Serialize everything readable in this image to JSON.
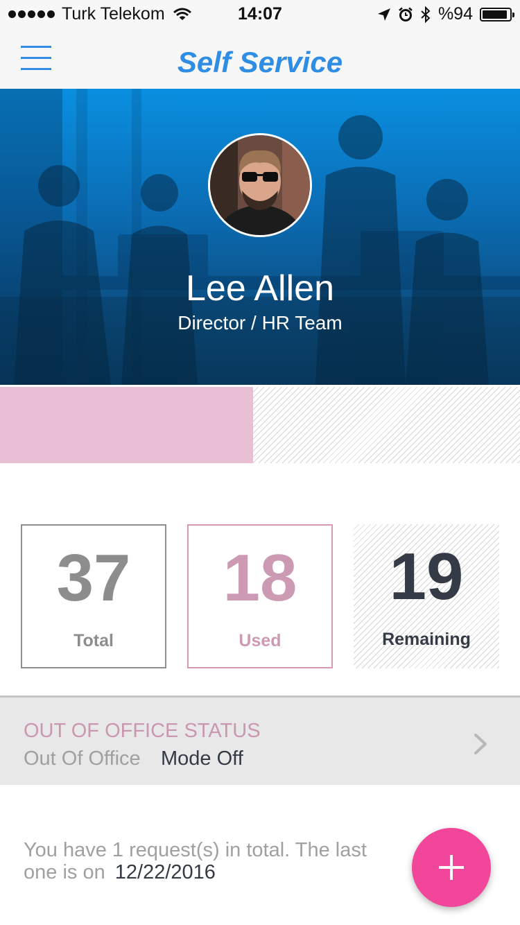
{
  "status_bar": {
    "carrier": "Turk Telekom",
    "time": "14:07",
    "battery_text": "%94",
    "battery_level": 0.94,
    "icons": [
      "signal-dots-icon",
      "wifi-icon",
      "location-arrow-icon",
      "alarm-icon",
      "bluetooth-icon",
      "battery-icon"
    ]
  },
  "nav": {
    "title": "Self Service",
    "menu_icon": "hamburger-menu-icon",
    "accent_color": "#2f8de4"
  },
  "profile": {
    "name": "Lee Allen",
    "role": "Director / HR Team",
    "avatar_icon": "user-avatar"
  },
  "leave": {
    "used_fraction": 0.486,
    "used_color": "#e8bfd4",
    "stats": [
      {
        "key": "total",
        "value": "37",
        "label": "Total",
        "color": "#8d8d8d"
      },
      {
        "key": "used",
        "value": "18",
        "label": "Used",
        "color": "#cc9bb3"
      },
      {
        "key": "remaining",
        "value": "19",
        "label": "Remaining",
        "color": "#343a46"
      }
    ]
  },
  "out_of_office": {
    "title": "OUT OF OFFICE STATUS",
    "status_label": "Out Of Office",
    "status_value": "Mode Off",
    "chevron_icon": "chevron-right-icon"
  },
  "requests": {
    "summary": "You have 1 request(s) in total. The last one is on",
    "last_date": "12/22/2016"
  },
  "fab": {
    "icon": "plus-icon",
    "color": "#f2469a"
  }
}
